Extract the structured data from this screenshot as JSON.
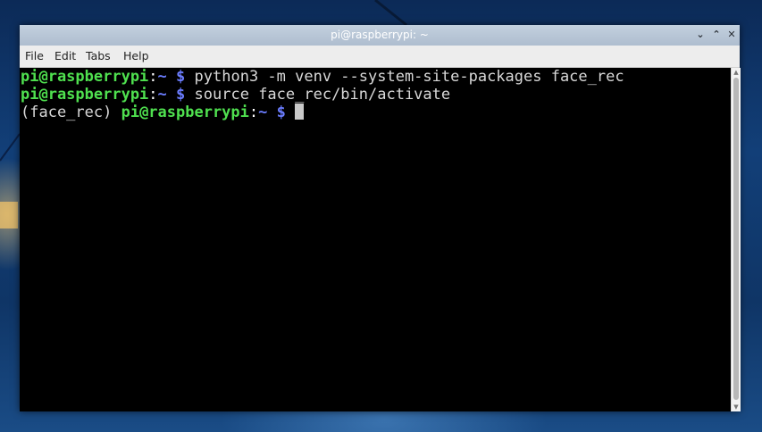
{
  "window": {
    "title": "pi@raspberrypi: ~",
    "controls": {
      "minimize_icon": "chevron-down-icon",
      "maximize_icon": "chevron-up-icon",
      "close_icon": "close-icon"
    }
  },
  "menu": {
    "items": [
      "File",
      "Edit",
      "Tabs",
      "Help"
    ]
  },
  "terminal": {
    "lines": [
      {
        "venv": "",
        "user_host": "pi@raspberrypi",
        "colon": ":",
        "path": "~",
        "prompt": "$",
        "command": "python3 -m venv --system-site-packages face_rec"
      },
      {
        "venv": "",
        "user_host": "pi@raspberrypi",
        "colon": ":",
        "path": "~",
        "prompt": "$",
        "command": "source face_rec/bin/activate"
      },
      {
        "venv": "(face_rec) ",
        "user_host": "pi@raspberrypi",
        "colon": ":",
        "path": "~",
        "prompt": "$",
        "command": ""
      }
    ]
  },
  "colors": {
    "user_host": "#4fe04f",
    "path": "#6b7dff",
    "text": "#d8d8d8",
    "background": "#000000",
    "titlebar": "#b8c6d6"
  }
}
